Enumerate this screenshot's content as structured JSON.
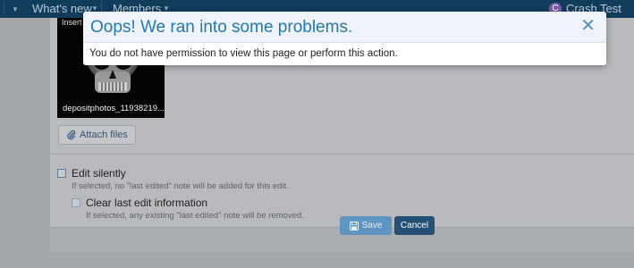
{
  "nav": {
    "whats_new": "What's new",
    "members": "Members",
    "user_initial": "C",
    "user_name": "Crash Test"
  },
  "attachment": {
    "thumb_label": "Insert",
    "filename": "depositphotos_11938219..."
  },
  "attach_button": "Attach files",
  "options": {
    "edit_silently": {
      "label": "Edit silently",
      "hint": "If selected, no \"last edited\" note will be added for this edit.",
      "checked": false
    },
    "clear_last_edit": {
      "label": "Clear last edit information",
      "hint": "If selected, any existing \"last edited\" note will be removed.",
      "checked": false
    }
  },
  "buttons": {
    "save": "Save",
    "cancel": "Cancel"
  },
  "dialog": {
    "title": "Oops! We ran into some problems.",
    "close_glyph": "✕",
    "message": "You do not have permission to view this page or perform this action."
  },
  "colors": {
    "nav_bg": "#113c5c",
    "dialog_title": "#2577b1",
    "save_button": "#5f95c0",
    "cancel_button": "#254f74"
  },
  "icons": {
    "attach": "paperclip-icon",
    "save": "floppy-disk-icon",
    "close": "close-icon"
  }
}
